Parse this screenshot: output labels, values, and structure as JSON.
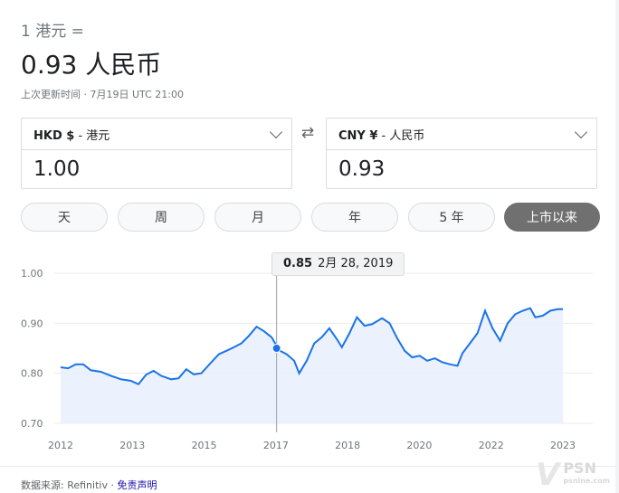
{
  "summary": {
    "from_line": "1 港元 =",
    "rate_line": "0.93 人民币",
    "updated": "上次更新时间 · 7月19日 UTC 21:00"
  },
  "converter": {
    "left": {
      "currency_code": "HKD $",
      "currency_name": " - 港元",
      "value": "1.00"
    },
    "right": {
      "currency_code": "CNY ¥",
      "currency_name": " - 人民币",
      "value": "0.93"
    }
  },
  "ranges": [
    "天",
    "周",
    "月",
    "年",
    "5 年",
    "上市以来"
  ],
  "active_range": "上市以来",
  "tooltip": {
    "value": "0.85",
    "date": "2月 28, 2019"
  },
  "chart_data": {
    "type": "area",
    "x_ticks": [
      "2012",
      "2013",
      "2015",
      "2017",
      "2018",
      "2020",
      "2022",
      "2023"
    ],
    "y_ticks": [
      "1.00",
      "0.90",
      "0.80",
      "0.70"
    ],
    "ylim": [
      0.7,
      1.0
    ],
    "grid": true,
    "line_color": "#1a73e8",
    "fill_color": "#e8f0fe",
    "highlight": {
      "t": 0.43,
      "value": 0.85
    },
    "points": [
      [
        0.0,
        0.812
      ],
      [
        0.015,
        0.81
      ],
      [
        0.03,
        0.818
      ],
      [
        0.045,
        0.818
      ],
      [
        0.06,
        0.806
      ],
      [
        0.08,
        0.803
      ],
      [
        0.1,
        0.795
      ],
      [
        0.12,
        0.788
      ],
      [
        0.14,
        0.785
      ],
      [
        0.155,
        0.778
      ],
      [
        0.17,
        0.797
      ],
      [
        0.185,
        0.805
      ],
      [
        0.2,
        0.795
      ],
      [
        0.22,
        0.788
      ],
      [
        0.235,
        0.79
      ],
      [
        0.25,
        0.808
      ],
      [
        0.265,
        0.798
      ],
      [
        0.28,
        0.8
      ],
      [
        0.3,
        0.822
      ],
      [
        0.315,
        0.838
      ],
      [
        0.33,
        0.845
      ],
      [
        0.345,
        0.852
      ],
      [
        0.36,
        0.86
      ],
      [
        0.375,
        0.875
      ],
      [
        0.39,
        0.893
      ],
      [
        0.405,
        0.884
      ],
      [
        0.42,
        0.872
      ],
      [
        0.435,
        0.846
      ],
      [
        0.45,
        0.838
      ],
      [
        0.465,
        0.825
      ],
      [
        0.475,
        0.8
      ],
      [
        0.49,
        0.825
      ],
      [
        0.505,
        0.86
      ],
      [
        0.52,
        0.872
      ],
      [
        0.535,
        0.89
      ],
      [
        0.55,
        0.868
      ],
      [
        0.56,
        0.852
      ],
      [
        0.575,
        0.88
      ],
      [
        0.59,
        0.912
      ],
      [
        0.605,
        0.895
      ],
      [
        0.62,
        0.898
      ],
      [
        0.64,
        0.91
      ],
      [
        0.655,
        0.9
      ],
      [
        0.67,
        0.87
      ],
      [
        0.685,
        0.845
      ],
      [
        0.7,
        0.832
      ],
      [
        0.715,
        0.835
      ],
      [
        0.73,
        0.825
      ],
      [
        0.745,
        0.83
      ],
      [
        0.76,
        0.822
      ],
      [
        0.775,
        0.818
      ],
      [
        0.79,
        0.815
      ],
      [
        0.8,
        0.84
      ],
      [
        0.815,
        0.86
      ],
      [
        0.83,
        0.88
      ],
      [
        0.845,
        0.925
      ],
      [
        0.86,
        0.89
      ],
      [
        0.875,
        0.865
      ],
      [
        0.89,
        0.9
      ],
      [
        0.905,
        0.918
      ],
      [
        0.92,
        0.925
      ],
      [
        0.935,
        0.93
      ],
      [
        0.945,
        0.912
      ],
      [
        0.96,
        0.915
      ],
      [
        0.975,
        0.925
      ],
      [
        0.99,
        0.928
      ],
      [
        1.0,
        0.928
      ]
    ]
  },
  "footer": {
    "source_label": "数据来源: ",
    "source_value": "Refinitiv",
    "separator": " · ",
    "disclaimer": "免责声明"
  },
  "watermark": {
    "main": "PSN",
    "sub": "psnine.com"
  }
}
